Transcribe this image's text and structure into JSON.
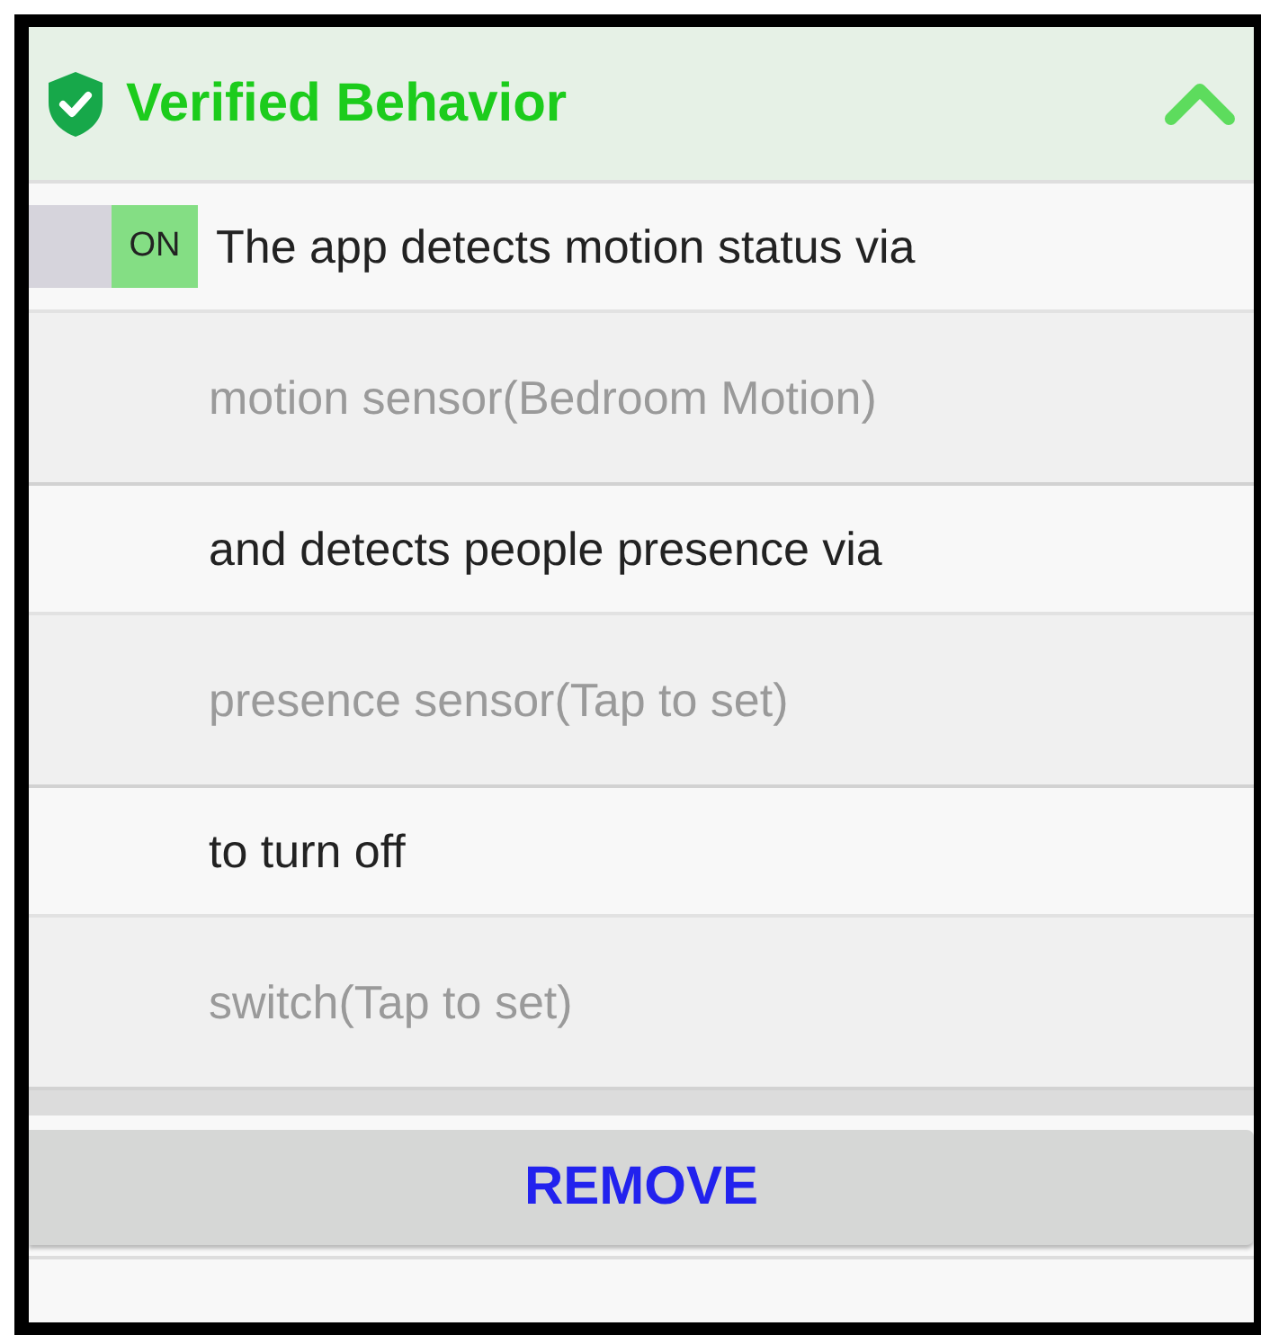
{
  "header": {
    "title": "Verified Behavior",
    "expanded": true
  },
  "rows": [
    {
      "kind": "statement",
      "text": "The app detects motion status via",
      "toggle": {
        "label": "ON",
        "on": true
      }
    },
    {
      "kind": "device",
      "text": "motion sensor(Bedroom Motion)"
    },
    {
      "kind": "statement",
      "text": "and detects people presence via"
    },
    {
      "kind": "device",
      "text": "presence sensor(Tap to set)"
    },
    {
      "kind": "statement",
      "text": "to turn off"
    },
    {
      "kind": "device",
      "text": "switch(Tap to set)"
    }
  ],
  "button": {
    "label": "REMOVE"
  }
}
